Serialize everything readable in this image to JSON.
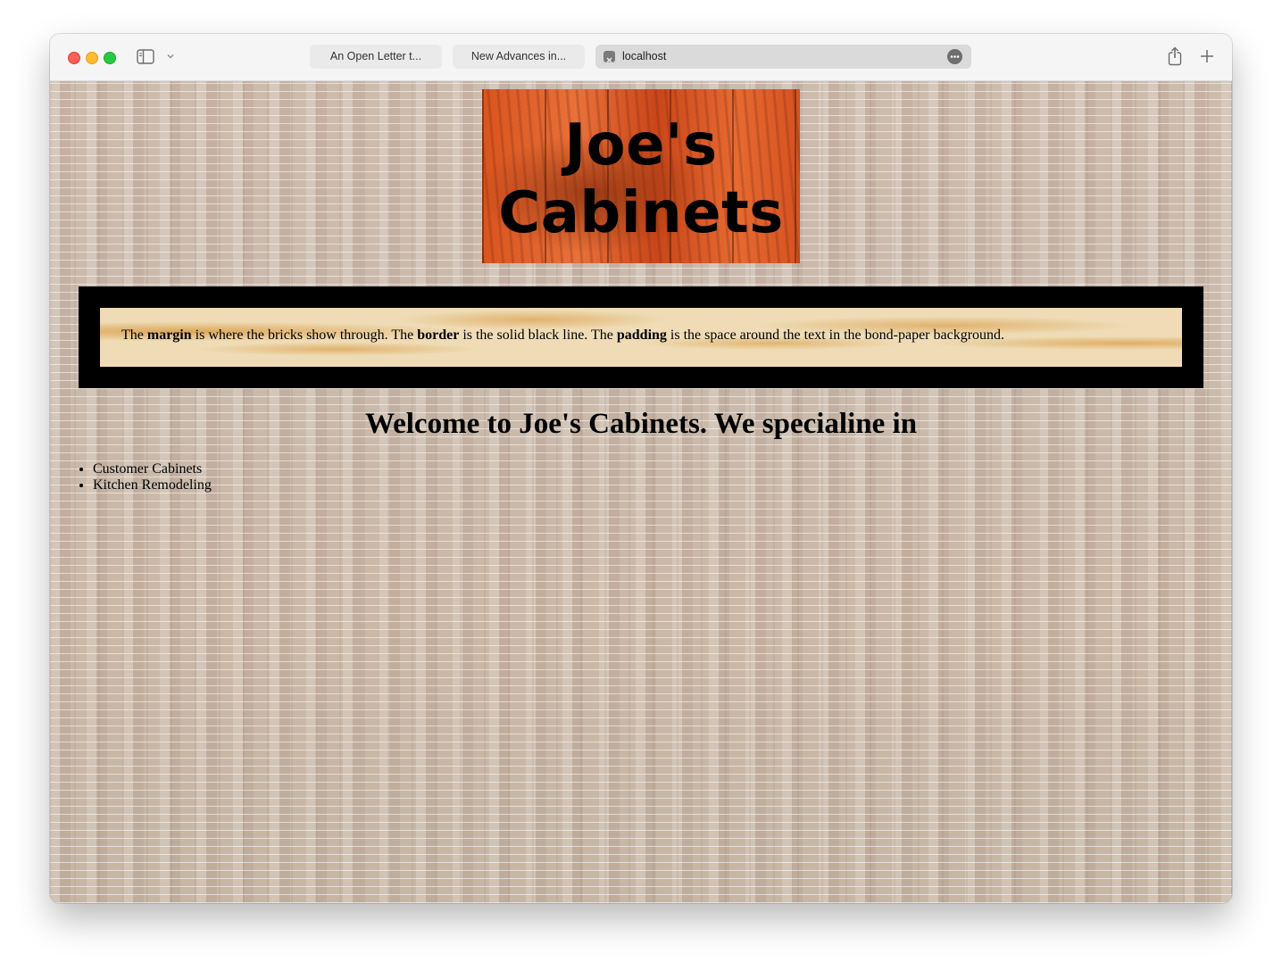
{
  "browser": {
    "tabs": [
      {
        "label": "An Open Letter t..."
      },
      {
        "label": "New Advances in..."
      }
    ],
    "active_tab": {
      "label": "localhost"
    }
  },
  "page": {
    "logo": {
      "line1": "Joe's",
      "line2": "Cabinets"
    },
    "box": {
      "t1": "The ",
      "b1": "margin",
      "t2": " is where the bricks show through. The ",
      "b2": "border",
      "t3": " is the solid black line. The ",
      "b3": "padding",
      "t4": " is the space around the text in the bond-paper background."
    },
    "welcome": "Welcome to Joe's Cabinets. We specialine in",
    "services": [
      "Customer Cabinets",
      "Kitchen Remodeling"
    ]
  }
}
